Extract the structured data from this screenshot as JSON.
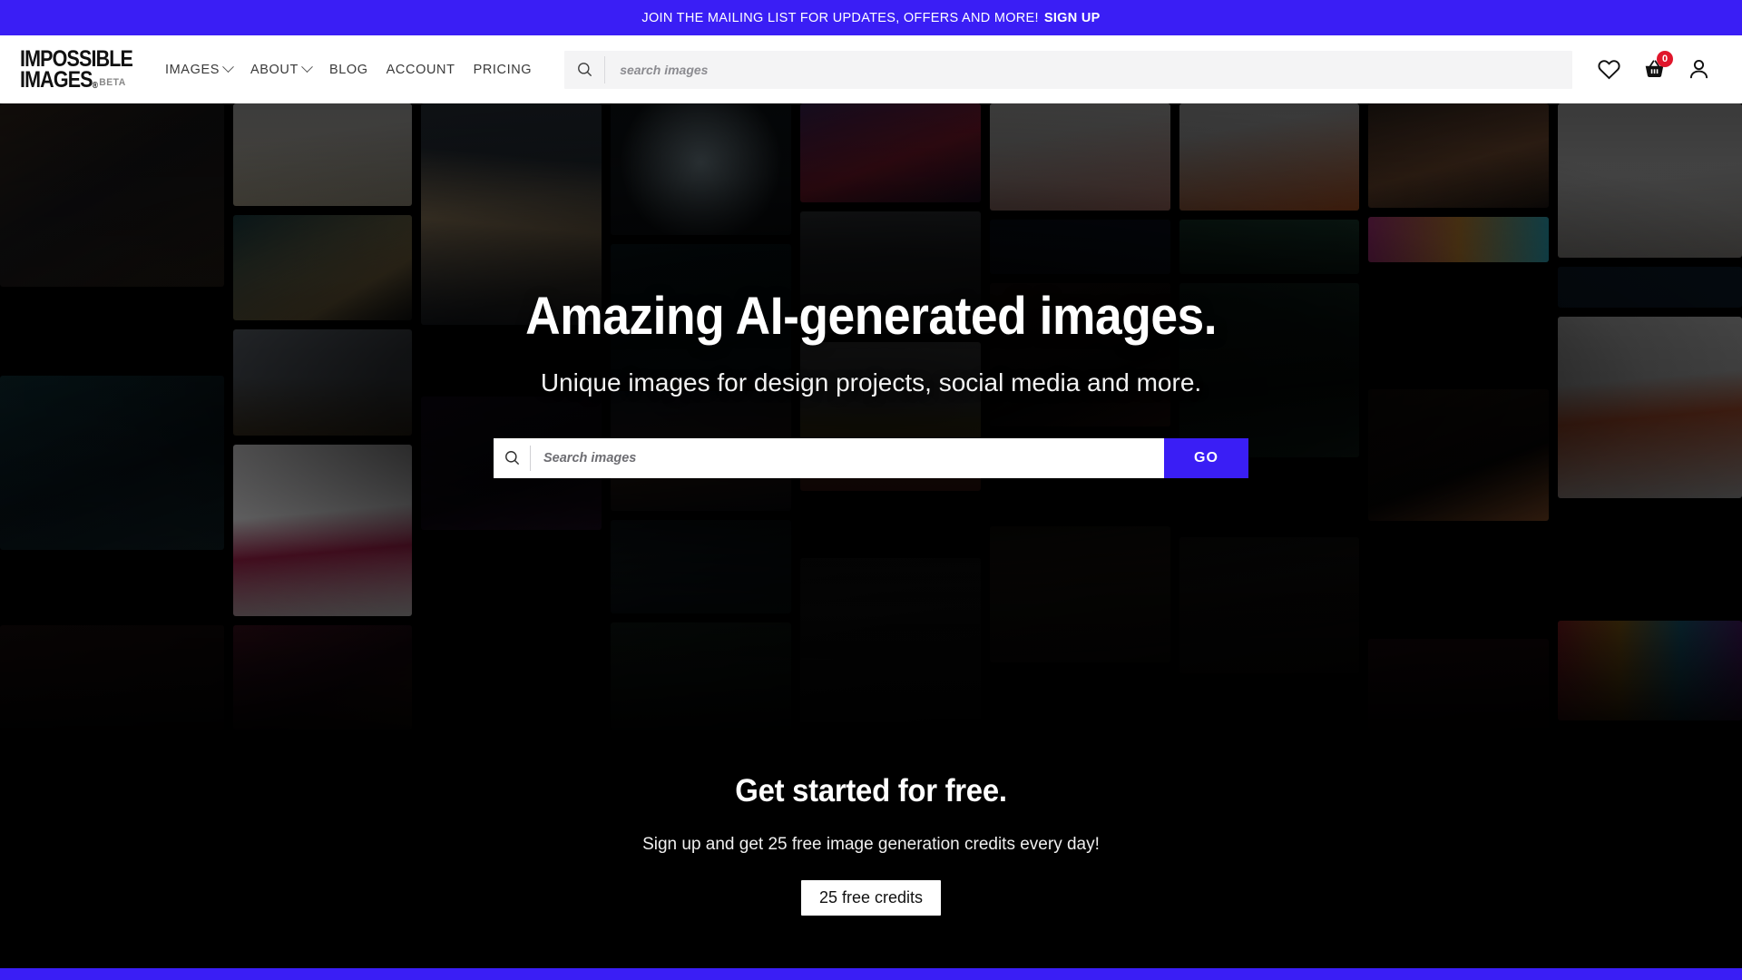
{
  "promo": {
    "text": "JOIN THE MAILING LIST FOR UPDATES, OFFERS AND MORE!",
    "signup_label": "SIGN UP",
    "background_color": "#3a1ef5"
  },
  "header": {
    "logo": {
      "line1": "IMPOSSIBLE",
      "line2": "IMAGES",
      "registered": "®",
      "badge": "BETA"
    },
    "nav": [
      {
        "label": "IMAGES",
        "has_dropdown": true,
        "name": "nav-item-images"
      },
      {
        "label": "ABOUT",
        "has_dropdown": true,
        "name": "nav-item-about"
      },
      {
        "label": "BLOG",
        "has_dropdown": false,
        "name": "nav-item-blog"
      },
      {
        "label": "ACCOUNT",
        "has_dropdown": false,
        "name": "nav-item-account"
      },
      {
        "label": "PRICING",
        "has_dropdown": false,
        "name": "nav-item-pricing"
      }
    ],
    "search": {
      "value": "",
      "placeholder": "search images",
      "icon": "search-icon"
    },
    "icons": [
      {
        "name": "heart-icon",
        "label": "Favourites"
      },
      {
        "name": "basket-icon",
        "label": "Basket",
        "badge": "0",
        "badge_color": "#e0162b"
      },
      {
        "name": "account-icon",
        "label": "Account"
      }
    ]
  },
  "hero": {
    "title": "Amazing AI-generated images.",
    "subtitle": "Unique images for design projects, social media and more.",
    "search": {
      "value": "",
      "placeholder": "Search images",
      "icon": "search-icon"
    },
    "go_label": "GO",
    "go_color": "#3a1ef5"
  },
  "get_started": {
    "title": "Get started for free.",
    "subtitle": "Sign up and get 25 free image generation credits every day!",
    "button_label": "25 free credits"
  },
  "footer": {
    "accent_color": "#3a1ef5"
  }
}
